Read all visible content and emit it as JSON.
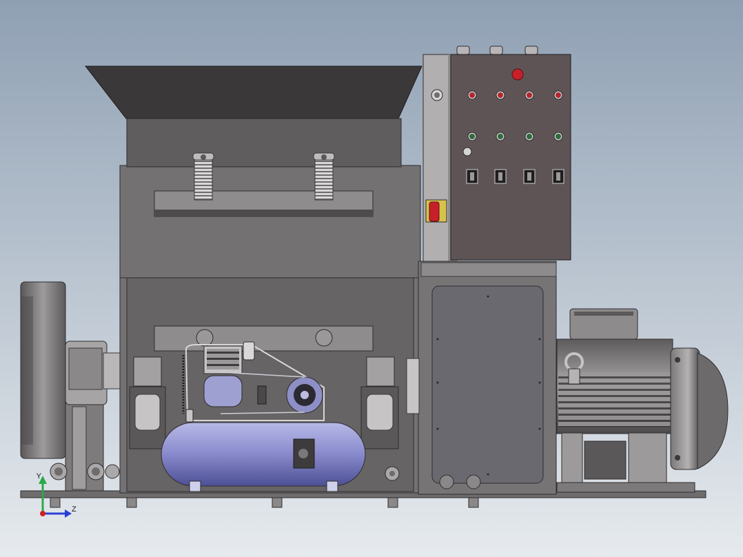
{
  "viewport": {
    "background_top": "#8fa0b3",
    "background_bottom": "#e6eaee"
  },
  "colors": {
    "steel": "#6e6c6d",
    "steel_light": "#9c9a9b",
    "steel_dark": "#4a4849",
    "hopper": "#3a3839",
    "panel": "#5e5456",
    "panel_door": "#6a5f62",
    "tank": "#8a8cc8",
    "red_lamp": "#b3262a",
    "green_lamp": "#2f6a3c",
    "isolator": "#c8202a",
    "isolator_plate": "#d6c24a",
    "motor": "#8d8b8c"
  },
  "control_panel": {
    "indicator_rows": [
      "red",
      "green"
    ],
    "indicators_per_row": 4,
    "switches": 4
  },
  "triad": {
    "y_label": "Y",
    "z_label": "Z",
    "y_color": "#2aa84a",
    "z_color": "#2a3fd6",
    "x_color": "#d02020"
  }
}
